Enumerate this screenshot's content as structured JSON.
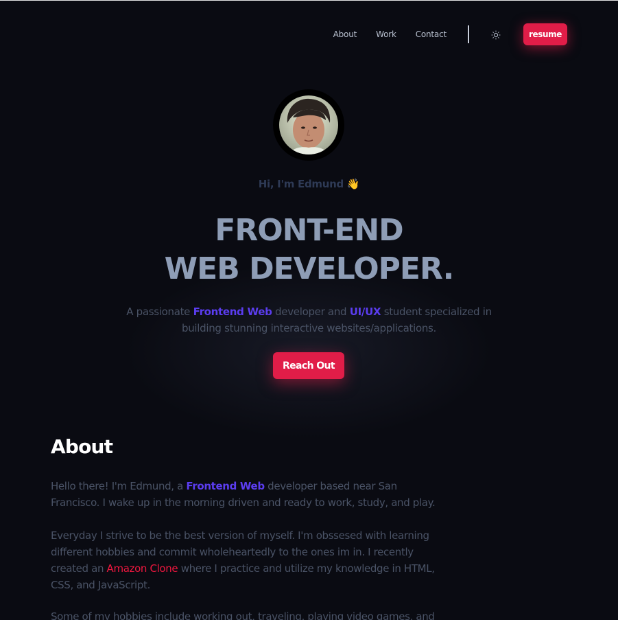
{
  "nav": {
    "links": [
      "About",
      "Work",
      "Contact"
    ],
    "theme_icon": "sun-icon",
    "resume_label": "resume"
  },
  "hero": {
    "greeting": "Hi, I'm Edmund",
    "wave_emoji": "👋",
    "headline_line1": "FRONT-END",
    "headline_line2": "WEB DEVELOPER.",
    "tagline_prefix": "A passionate ",
    "tagline_highlight1": "Frontend Web",
    "tagline_mid": " developer and ",
    "tagline_highlight2": "UI/UX",
    "tagline_suffix": " student specialized in building stunning interactive websites/applications.",
    "cta_label": "Reach Out"
  },
  "about": {
    "title": "About",
    "p1_prefix": "Hello there! I'm Edmund, a ",
    "p1_highlight": "Frontend Web",
    "p1_suffix": " developer based near San Francisco. I wake up in the morning driven and ready to work, study, and play.",
    "p2_prefix": "Everyday I strive to be the best version of myself. I'm obssesed with learning different hobbies and commit wholeheartedly to the ones im in. I recently created an ",
    "p2_link": "Amazon Clone",
    "p2_suffix": " where I practice and utilize my knowledge in HTML, CSS, and JavaScript.",
    "p3": "Some of my hobbies include working out, traveling, playing video games, and"
  },
  "colors": {
    "background": "#0a0b12",
    "accent_red": "#e11d48",
    "highlight_purple": "#5b3df0",
    "headline": "#8e9db6"
  }
}
